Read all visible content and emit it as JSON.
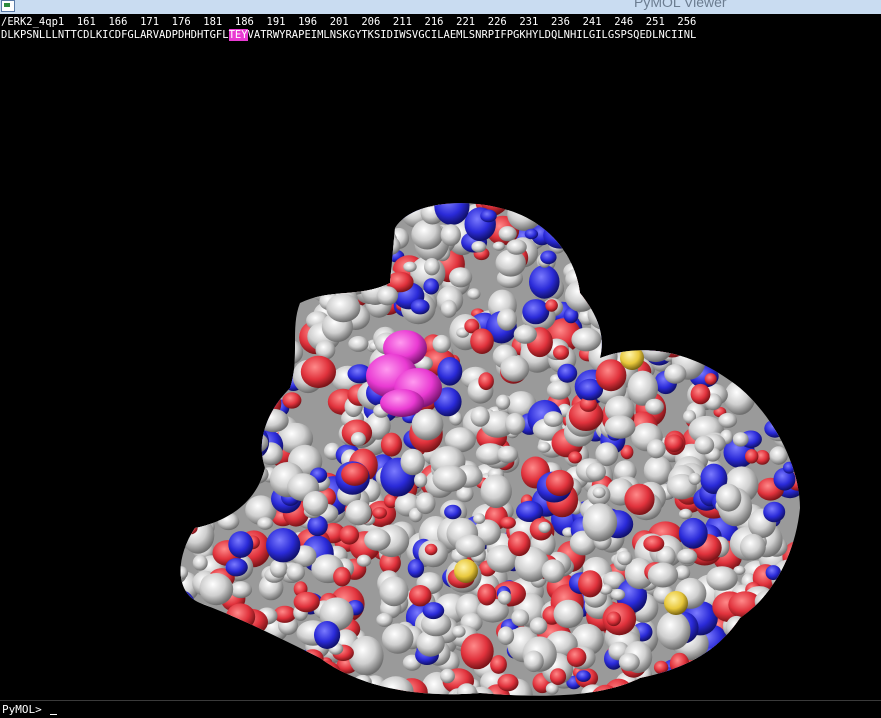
{
  "window": {
    "title": "PyMOL Viewer"
  },
  "sequence": {
    "numbers_line": "/ERK2_4qp1  161  166  171  176  181  186  191  196  201  206  211  216  221  226  231  236  241  246  251  256",
    "residues_before": "DLKPSNLLLNTTCDLKICDFGLARVADPDHDHTGFL",
    "residues_selected": "TEY",
    "residues_after": "VATRWYRAPEIMLNSKGYTKSIDIWSVGCILAEMLSNRPIFPGKHYLDQLNHILGILGSPSQEDLNCIINL"
  },
  "command": {
    "prompt": "PyMOL>"
  },
  "colors": {
    "surface_base": "#c8c8c8",
    "oxygen": "#e0323c",
    "nitrogen": "#2a2ad8",
    "sulfur": "#e8c83c",
    "selection": "#e93ad2"
  }
}
